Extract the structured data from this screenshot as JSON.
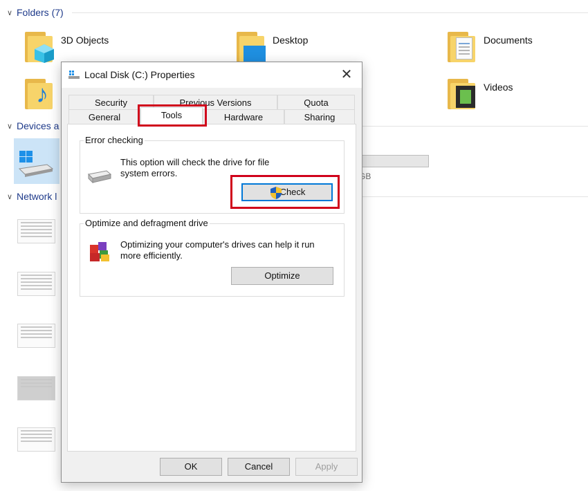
{
  "explorer": {
    "folders_header": "Folders (7)",
    "folders": [
      {
        "name": "3D Objects"
      },
      {
        "name": "Desktop"
      },
      {
        "name": "Documents"
      },
      {
        "name": "Videos"
      }
    ],
    "devices_header": "Devices a",
    "network_header": "Network l",
    "drive_size_fragment": "GB"
  },
  "dialog": {
    "title": "Local Disk (C:) Properties",
    "tabs_row1": [
      "Security",
      "Previous Versions",
      "Quota"
    ],
    "tabs_row2": [
      "General",
      "Tools",
      "Hardware",
      "Sharing"
    ],
    "active_tab": "Tools",
    "error_checking": {
      "title": "Error checking",
      "description_line1": "This option will check the drive for file",
      "description_line2": "system errors.",
      "button": "Check"
    },
    "optimize": {
      "title": "Optimize and defragment drive",
      "description_line1": "Optimizing your computer's drives can help it run",
      "description_line2": "more efficiently.",
      "button": "Optimize"
    },
    "footer": {
      "ok": "OK",
      "cancel": "Cancel",
      "apply": "Apply"
    }
  },
  "colors": {
    "highlight": "#d0021b",
    "focus_border": "#0078d7",
    "folder_yellow": "#f7d46a"
  }
}
